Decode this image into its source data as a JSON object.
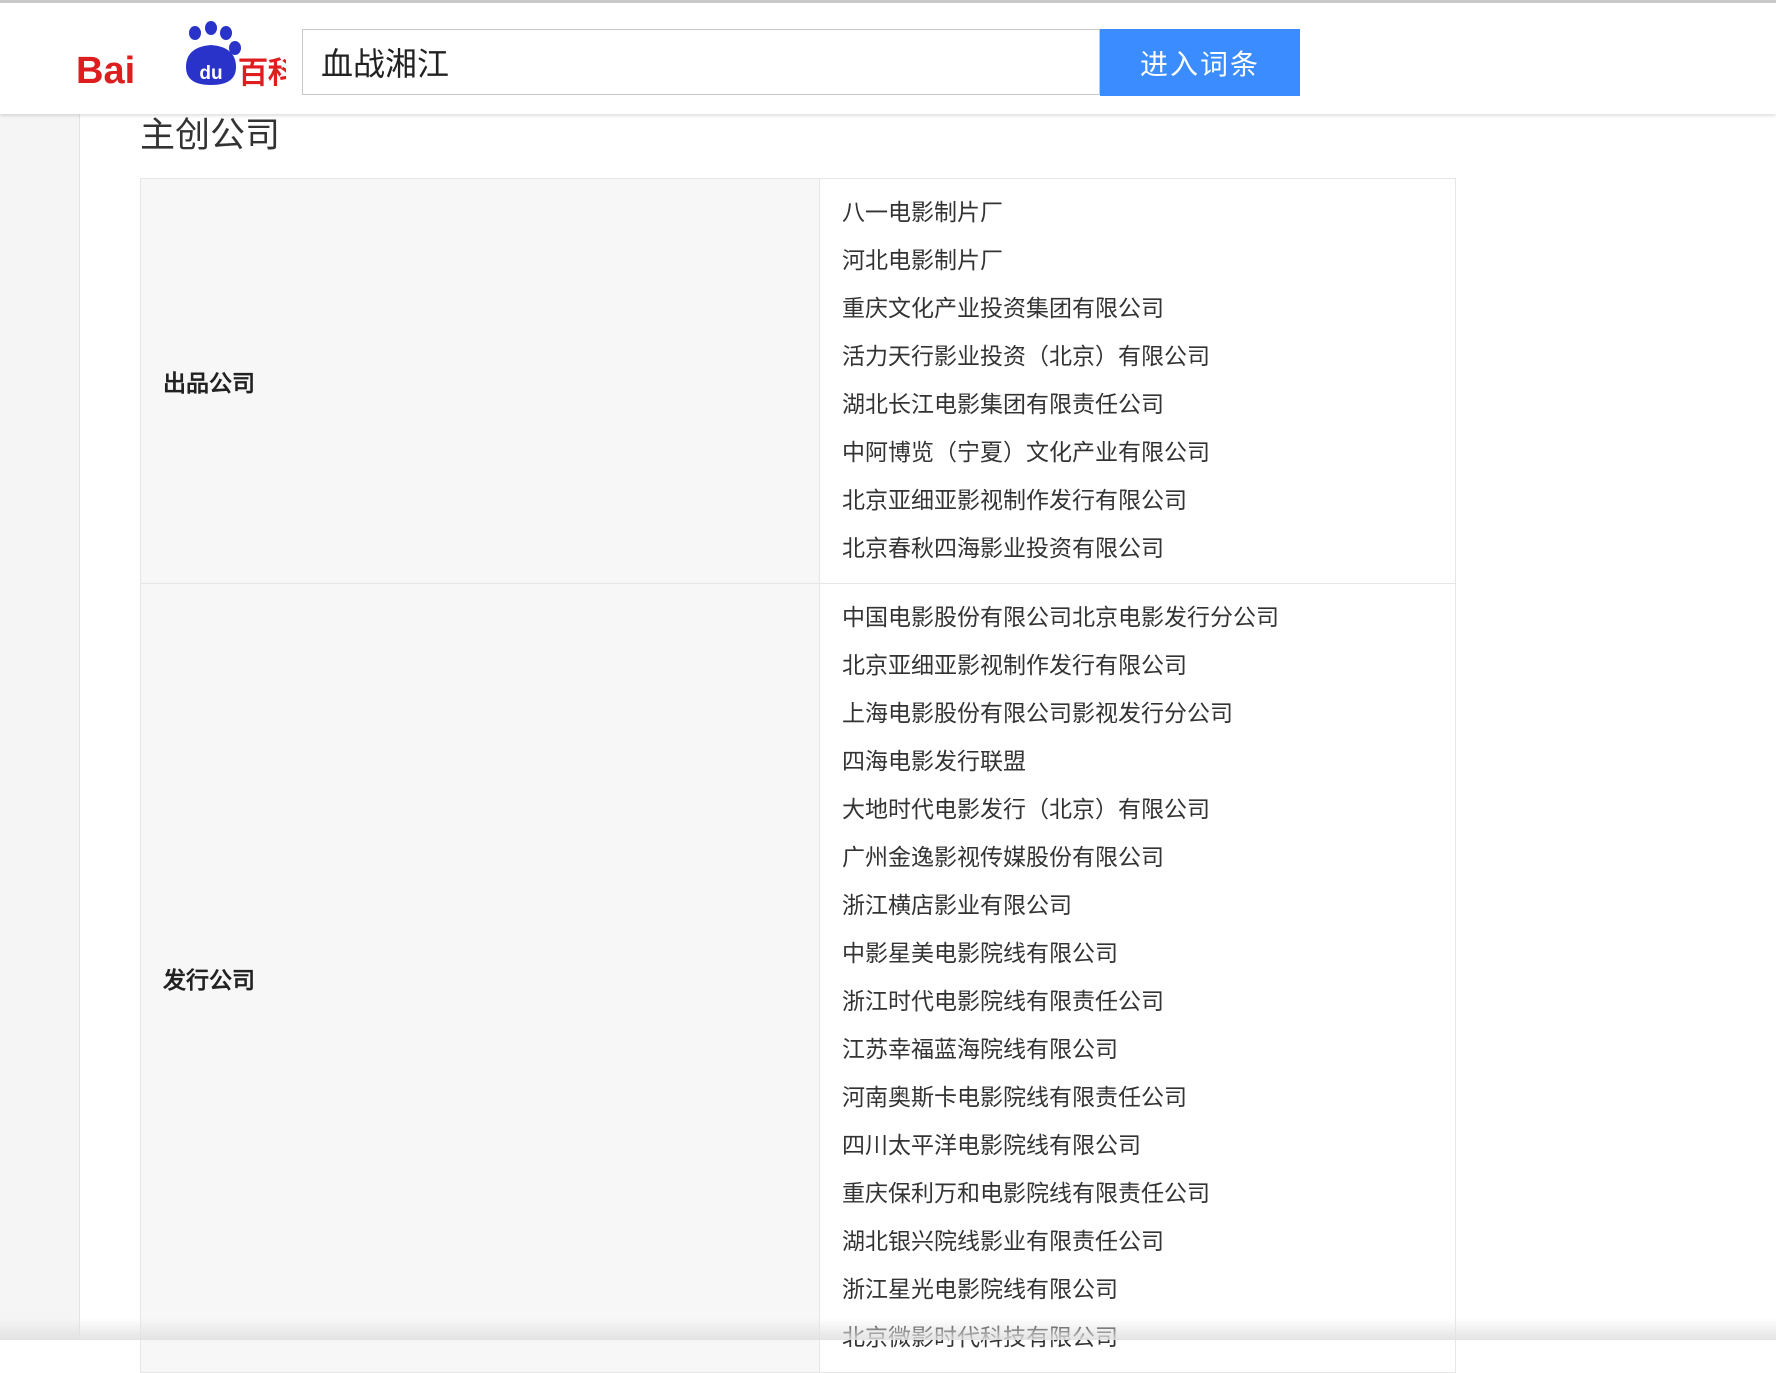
{
  "header": {
    "logo_text": "Baidu百科",
    "logo_colors": {
      "red": "#de1e1e",
      "blue": "#2a33c9"
    },
    "search_value": "血战湘江",
    "search_button_label": "进入词条",
    "accent": "#3b8cff"
  },
  "section": {
    "title": "主创公司",
    "rows": [
      {
        "label": "出品公司",
        "companies": [
          "八一电影制片厂",
          "河北电影制片厂",
          "重庆文化产业投资集团有限公司",
          "活力天行影业投资（北京）有限公司",
          "湖北长江电影集团有限责任公司",
          "中阿博览（宁夏）文化产业有限公司",
          "北京亚细亚影视制作发行有限公司",
          "北京春秋四海影业投资有限公司"
        ]
      },
      {
        "label": "发行公司",
        "companies": [
          "中国电影股份有限公司北京电影发行分公司",
          "北京亚细亚影视制作发行有限公司",
          "上海电影股份有限公司影视发行分公司",
          "四海电影发行联盟",
          "大地时代电影发行（北京）有限公司",
          "广州金逸影视传媒股份有限公司",
          "浙江横店影业有限公司",
          "中影星美电影院线有限公司",
          "浙江时代电影院线有限责任公司",
          "江苏幸福蓝海院线有限公司",
          "河南奥斯卡电影院线有限责任公司",
          "四川太平洋电影院线有限公司",
          "重庆保利万和电影院线有限责任公司",
          "湖北银兴院线影业有限责任公司",
          "浙江星光电影院线有限公司",
          "北京微影时代科技有限公司"
        ]
      }
    ]
  }
}
